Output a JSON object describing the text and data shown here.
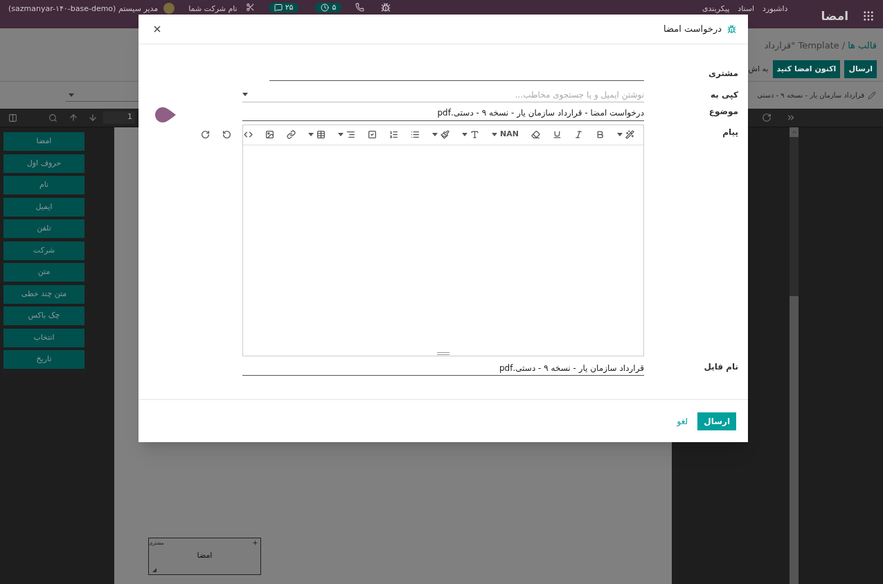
{
  "top_bar": {
    "brand": "امضا",
    "menu": [
      "داشبورد",
      "اسناد",
      "پیکربندی"
    ],
    "company": "نام شرکت شما",
    "activity_count": "۵",
    "message_count": "۲۵",
    "user": "مدیر سیستم",
    "database": "(sazmanyar-۱۴۰-base-demo)"
  },
  "control_panel": {
    "breadcrumb": [
      {
        "label": "قالب ها",
        "link": true
      },
      {
        "label": "Template \"قرارداد",
        "link": false
      }
    ],
    "separator": "/",
    "buttons": [
      {
        "label": "ارسال",
        "kind": "primary"
      },
      {
        "label": "اکنون امضا کنید",
        "kind": "primary"
      },
      {
        "label": "به اش",
        "kind": "link"
      }
    ],
    "document_name": "قرارداد سازمان یار - نسخه ۹ - دستی"
  },
  "viewer": {
    "page_number": "1",
    "field_types": [
      "امضا",
      "حروف اول",
      "نام",
      "ایمیل",
      "تلفن",
      "شرکت",
      "متن",
      "متن چند خطی",
      "چک باکس",
      "انتخاب",
      "تاریخ"
    ],
    "placed_fields": [
      {
        "role": "مشتری",
        "label": "امضا"
      }
    ]
  },
  "dialog": {
    "title": "درخواست امضا",
    "fields": [
      {
        "label": "مشتری",
        "kind": "line"
      },
      {
        "label": "کپی به",
        "kind": "tags",
        "placeholder": "نوشتن ایمیل و یا جستجوی مخاطب..."
      },
      {
        "label": "موضوع",
        "kind": "line",
        "value": "درخواست امضا - قرارداد سازمان یار - نسخه ۹ - دستی.pdf"
      },
      {
        "label": "پیام",
        "kind": "editor",
        "font_size": "NAN"
      },
      {
        "label": "نام فایل",
        "kind": "line",
        "value": "قرارداد سازمان یار - نسخه ۹ - دستی.pdf"
      }
    ],
    "buttons": [
      {
        "label": "ارسال",
        "kind": "primary"
      },
      {
        "label": "لغو",
        "kind": "link"
      }
    ]
  }
}
